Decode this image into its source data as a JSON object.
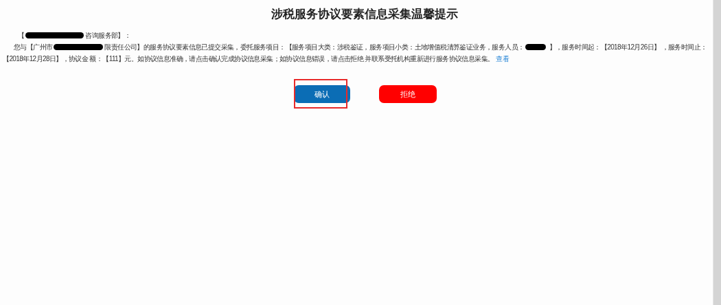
{
  "title": "涉税服务协议要素信息采集温馨提示",
  "greeting": [
    {
      "kind": "text",
      "text": "【"
    },
    {
      "kind": "redacted"
    },
    {
      "kind": "text",
      "text": "咨询服务部】："
    }
  ],
  "body_lines": [
    [
      {
        "kind": "text",
        "text": "您与【广州市"
      },
      {
        "kind": "redacted"
      },
      {
        "kind": "text",
        "text": "限责任公司】的服务协议要素信息已提交采集，委托服务项目：【服务项目大类：涉税鉴证，服务项目小类：土地增值税清算鉴证业务，服务人员："
      },
      {
        "kind": "redacted"
      },
      {
        "kind": "text",
        "text": " 】，服务时间起：【2018年12月26日】 ，服务时间止："
      }
    ],
    [
      {
        "kind": "text",
        "text": "【2018年12月28日】，协议金 额：【111】元。如协议信息准确，请点击确认完成协议信息采集；如协议信息错误，请点击拒绝 并联系受托机构重新进行服务协议信息采集。"
      },
      {
        "kind": "link",
        "text": "查看"
      }
    ]
  ],
  "buttons": [
    {
      "label": "确认",
      "kind": "confirm",
      "highlighted": true
    },
    {
      "label": "拒绝",
      "kind": "reject",
      "highlighted": false
    }
  ]
}
